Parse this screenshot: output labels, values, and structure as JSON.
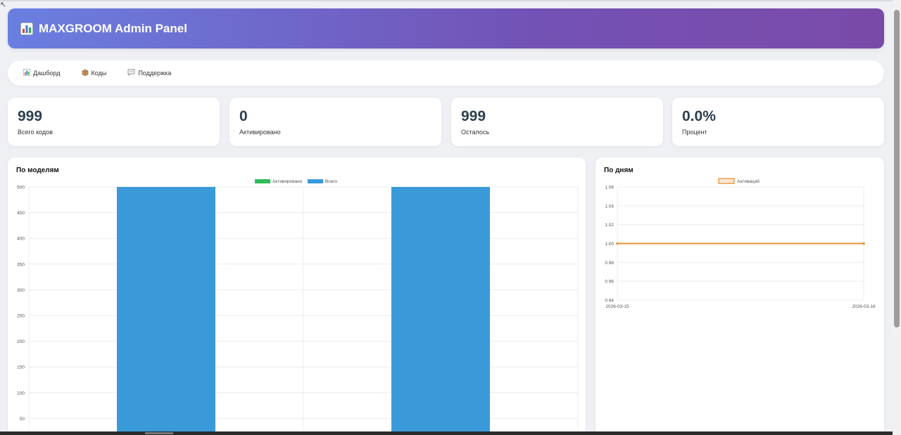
{
  "header": {
    "title": "MAXGROOM Admin Panel",
    "icon": "bar-chart-icon"
  },
  "nav": [
    {
      "label": "Дашборд",
      "icon": "bar-chart-icon"
    },
    {
      "label": "Коды",
      "icon": "package-icon"
    },
    {
      "label": "Поддержка",
      "icon": "speech-bubble-icon"
    }
  ],
  "stats": [
    {
      "value": "999",
      "label": "Всего кодов"
    },
    {
      "value": "0",
      "label": "Активировано"
    },
    {
      "value": "999",
      "label": "Осталось"
    },
    {
      "value": "0.0%",
      "label": "Процент"
    }
  ],
  "panels": {
    "models_title": "По моделям",
    "days_title": "По дням"
  },
  "chart_data": [
    {
      "type": "bar",
      "title": "По моделям",
      "categories": [
        "",
        ""
      ],
      "series": [
        {
          "name": "Активировано",
          "values": [
            0,
            0
          ],
          "color": "#2ebd59"
        },
        {
          "name": "Всего",
          "values": [
            500,
            500
          ],
          "color": "#3a9ad9"
        }
      ],
      "ylim": [
        0,
        500
      ],
      "yticks": [
        50,
        100,
        150,
        200,
        250,
        300,
        350,
        400,
        450,
        500
      ],
      "grid": true,
      "legend": "top-center"
    },
    {
      "type": "line",
      "title": "По дням",
      "x": [
        "2026-03-15",
        "2026-03-16"
      ],
      "series": [
        {
          "name": "Активаций",
          "values": [
            1.0,
            1.0
          ],
          "color": "#e8913a"
        }
      ],
      "ylim": [
        0.94,
        1.06
      ],
      "yticks": [
        "0.94",
        "0.96",
        "0.98",
        "1.00",
        "1.02",
        "1.04",
        "1.06"
      ],
      "grid": true,
      "legend": "top-center"
    }
  ]
}
